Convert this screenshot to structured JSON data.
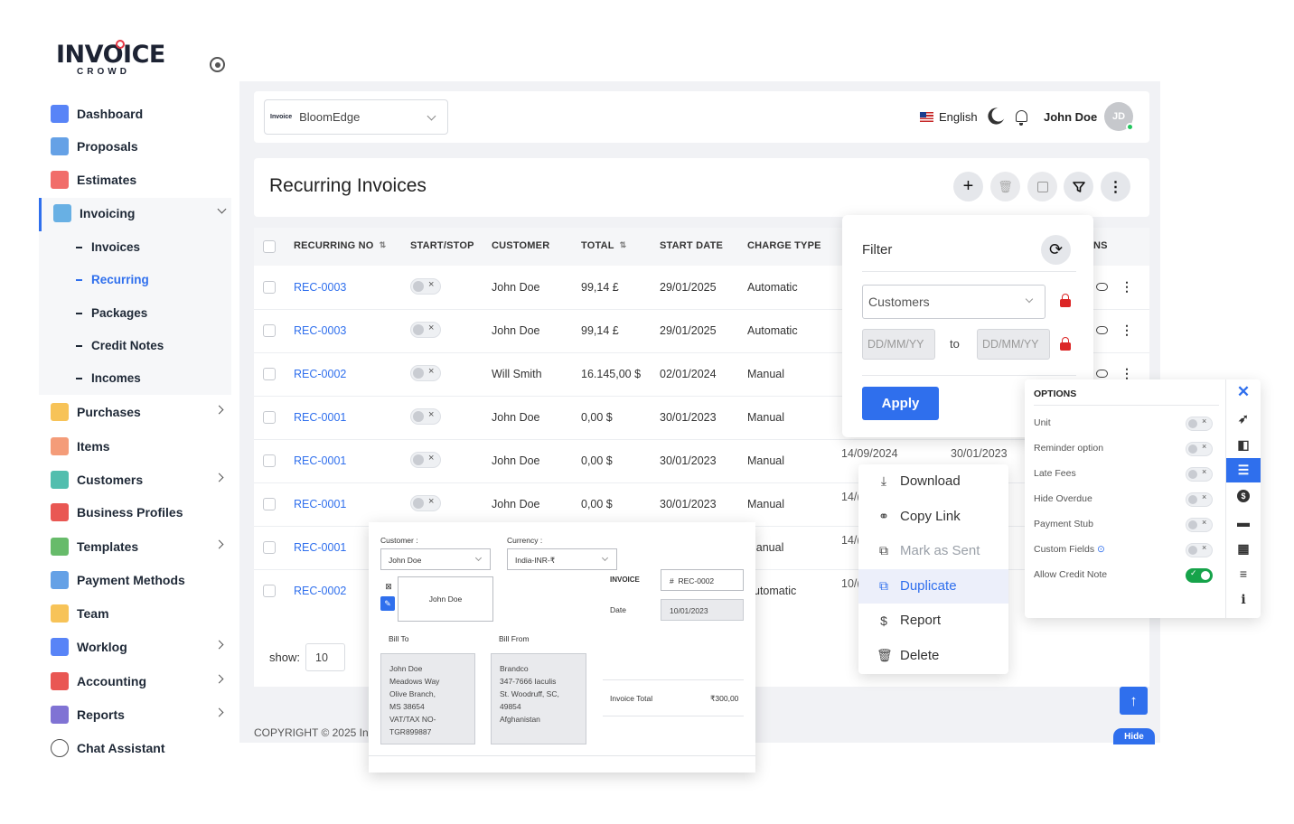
{
  "brand": {
    "word": "INVOICE",
    "sub": "CROWD"
  },
  "sidebar": {
    "items": [
      {
        "label": "Dashboard",
        "color": "#3b6ef6"
      },
      {
        "label": "Proposals",
        "color": "#4a90e2"
      },
      {
        "label": "Estimates",
        "color": "#ef5350"
      },
      {
        "label": "Invoicing",
        "color": "#4fa3e0"
      },
      {
        "label": "Purchases",
        "color": "#f6b93b"
      },
      {
        "label": "Items",
        "color": "#f28b62"
      },
      {
        "label": "Customers",
        "color": "#34b3a0"
      },
      {
        "label": "Business Profiles",
        "color": "#e53935"
      },
      {
        "label": "Templates",
        "color": "#4caf50"
      },
      {
        "label": "Payment Methods",
        "color": "#4a90e2"
      },
      {
        "label": "Team",
        "color": "#f6b93b"
      },
      {
        "label": "Worklog",
        "color": "#3b6ef6"
      },
      {
        "label": "Accounting",
        "color": "#e53935"
      },
      {
        "label": "Reports",
        "color": "#6a5acd"
      },
      {
        "label": "Chat Assistant",
        "color": "#333333"
      }
    ],
    "subitems": [
      "Invoices",
      "Recurring",
      "Packages",
      "Credit Notes",
      "Incomes"
    ]
  },
  "topbar": {
    "company": "BloomEdge",
    "company_logo_text": "Invoice",
    "language": "English",
    "user_name": "John Doe",
    "user_initials": "JD"
  },
  "page": {
    "title": "Recurring Invoices"
  },
  "table": {
    "headers": [
      "RECURRING NO",
      "START/STOP",
      "CUSTOMER",
      "TOTAL",
      "START DATE",
      "CHARGE TYPE",
      "NS"
    ],
    "rows": [
      {
        "no": "REC-0003",
        "customer": "John Doe",
        "total": "99,14 £",
        "start": "29/01/2025",
        "type": "Automatic"
      },
      {
        "no": "REC-0003",
        "customer": "John Doe",
        "total": "99,14 £",
        "start": "29/01/2025",
        "type": "Automatic"
      },
      {
        "no": "REC-0002",
        "customer": "Will Smith",
        "total": "16.145,00 $",
        "start": "02/01/2024",
        "type": "Manual"
      },
      {
        "no": "REC-0001",
        "customer": "John Doe",
        "total": "0,00 $",
        "start": "30/01/2023",
        "type": "Manual"
      },
      {
        "no": "REC-0001",
        "customer": "John Doe",
        "total": "0,00 $",
        "start": "30/01/2023",
        "type": "Manual",
        "extra1": "14/09/2024",
        "extra2": "30/01/2023"
      },
      {
        "no": "REC-0001",
        "customer": "John Doe",
        "total": "0,00 $",
        "start": "30/01/2023",
        "type": "Manual",
        "extra1": "14/("
      },
      {
        "no": "REC-0001",
        "customer": "",
        "total": "",
        "start": "",
        "type": "",
        "tail": "lanual",
        "extra1": "14/("
      },
      {
        "no": "REC-0002",
        "customer": "",
        "total": "",
        "start": "",
        "type": "",
        "tail": "utomatic",
        "extra1": "10/("
      }
    ],
    "show_label": "show:",
    "page_size": "10"
  },
  "footer": {
    "copyright": "COPYRIGHT © 2025 In",
    "hide_label": "Hide"
  },
  "filter": {
    "title": "Filter",
    "customer_placeholder": "Customers",
    "date_from": "DD/MM/YY",
    "date_to": "DD/MM/YY",
    "to_label": "to",
    "apply_label": "Apply"
  },
  "options": {
    "title": "OPTIONS",
    "items": [
      {
        "label": "Unit",
        "on": false
      },
      {
        "label": "Reminder option",
        "on": false
      },
      {
        "label": "Late Fees",
        "on": false
      },
      {
        "label": "Hide Overdue",
        "on": false
      },
      {
        "label": "Payment Stub",
        "on": false
      },
      {
        "label": "Custom Fields",
        "on": false
      },
      {
        "label": "Allow Credit Note",
        "on": true
      }
    ]
  },
  "actions_menu": {
    "items": [
      "Download",
      "Copy Link",
      "Mark as Sent",
      "Duplicate",
      "Report",
      "Delete"
    ]
  },
  "invoice_form": {
    "customer_label": "Customer :",
    "customer_value": "John Doe",
    "currency_label": "Currency :",
    "currency_value": "India-INR-₹",
    "card_name": "John Doe",
    "invoice_label": "INVOICE",
    "invoice_no": "REC-0002",
    "invoice_hash": "#",
    "date_label": "Date",
    "date_value": "10/01/2023",
    "bill_to_label": "Bill To",
    "bill_from_label": "Bill From",
    "bill_to_lines": [
      "John Doe",
      "Meadows Way",
      "Olive Branch,",
      "MS 38654",
      "VAT/TAX NO-",
      "TGR899887"
    ],
    "bill_from_lines": [
      "Brandco",
      "347-7666 Iaculis",
      "St. Woodruff, SC,",
      "49854",
      "Afghanistan"
    ],
    "total_label": "Invoice Total",
    "total_value": "₹300,00"
  },
  "colors": {
    "accent": "#2f6fed",
    "danger": "#dc2626",
    "success": "#16a34a"
  }
}
